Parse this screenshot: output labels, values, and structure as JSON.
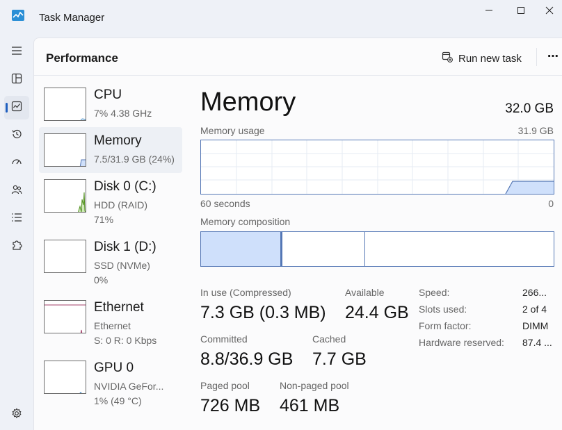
{
  "window": {
    "title": "Task Manager"
  },
  "header": {
    "title": "Performance",
    "run_new_task": "Run new task",
    "more": "⋯"
  },
  "colors": {
    "accent": "#1f5fbf",
    "memory_line": "#5477b5",
    "memory_fill": "#cfe0fb",
    "disk_line": "#4f8f1c",
    "ethernet_line": "#a3406a"
  },
  "resources": [
    {
      "name": "CPU",
      "sub1": "7% 4.38 GHz",
      "sub2": ""
    },
    {
      "name": "Memory",
      "sub1": "7.5/31.9 GB (24%)",
      "sub2": ""
    },
    {
      "name": "Disk 0 (C:)",
      "sub1": "HDD (RAID)",
      "sub2": "71%"
    },
    {
      "name": "Disk 1 (D:)",
      "sub1": "SSD (NVMe)",
      "sub2": "0%"
    },
    {
      "name": "Ethernet",
      "sub1": "Ethernet",
      "sub2": "S: 0 R: 0 Kbps"
    },
    {
      "name": "GPU 0",
      "sub1": "NVIDIA GeFor...",
      "sub2": "1% (49 °C)"
    }
  ],
  "detail": {
    "title": "Memory",
    "total": "32.0 GB",
    "usage_label": "Memory usage",
    "usage_max": "31.9 GB",
    "time_left": "60 seconds",
    "time_right": "0",
    "composition_label": "Memory composition",
    "composition_fractions": [
      0.23,
      0.235,
      0.535
    ]
  },
  "stats": {
    "in_use_label": "In use (Compressed)",
    "in_use_value": "7.3 GB (0.3 MB)",
    "available_label": "Available",
    "available_value": "24.4 GB",
    "committed_label": "Committed",
    "committed_value": "8.8/36.9 GB",
    "cached_label": "Cached",
    "cached_value": "7.7 GB",
    "paged_label": "Paged pool",
    "paged_value": "726 MB",
    "nonpaged_label": "Non-paged pool",
    "nonpaged_value": "461 MB"
  },
  "specs": {
    "speed_label": "Speed:",
    "speed_value": "266...",
    "slots_label": "Slots used:",
    "slots_value": "2 of 4",
    "form_label": "Form factor:",
    "form_value": "DIMM",
    "reserved_label": "Hardware reserved:",
    "reserved_value": "87.4 ..."
  }
}
